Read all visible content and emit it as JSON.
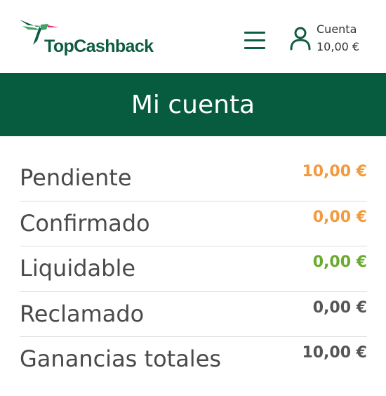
{
  "header": {
    "logo_text": "TopCashback",
    "account_label": "Cuenta",
    "account_balance": "10,00 €"
  },
  "icons": {
    "logo": "hummingbird-logo-icon",
    "menu": "hamburger-menu-icon",
    "account": "user-account-icon"
  },
  "colors": {
    "brand_green": "#075c3f",
    "pending_orange": "#f39a3d",
    "payable_green": "#6aaa2e",
    "neutral_gray": "#555555"
  },
  "page_title": "Mi cuenta",
  "stats": [
    {
      "label": "Pendiente",
      "value": "10,00 €",
      "color": "#f39a3d"
    },
    {
      "label": "Confirmado",
      "value": "0,00 €",
      "color": "#f39a3d"
    },
    {
      "label": "Liquidable",
      "value": "0,00 €",
      "color": "#6aaa2e"
    },
    {
      "label": "Reclamado",
      "value": "0,00 €",
      "color": "#555555"
    },
    {
      "label": "Ganancias totales",
      "value": "10,00 €",
      "color": "#555555"
    }
  ]
}
